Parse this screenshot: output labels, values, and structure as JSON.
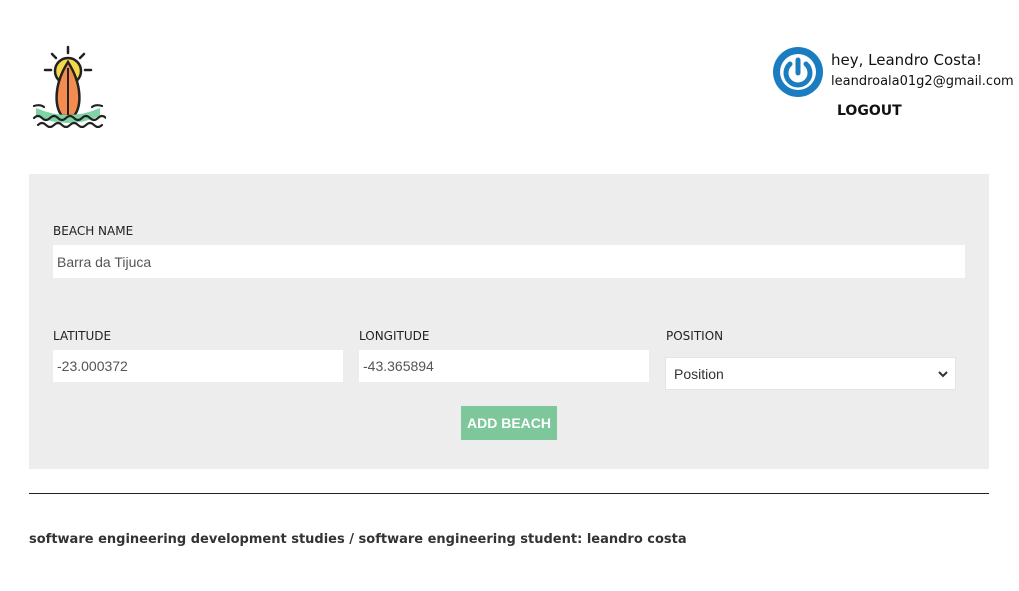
{
  "header": {
    "logo_icon": "surfboard-sun-icon",
    "user": {
      "avatar_icon": "power-icon",
      "greeting": "hey, Leandro Costa!",
      "email": "leandroala01g2@gmail.com",
      "logout_label": "LOGOUT"
    }
  },
  "form": {
    "beach_name": {
      "label": "BEACH NAME",
      "value": "Barra da Tijuca"
    },
    "latitude": {
      "label": "LATITUDE",
      "value": "-23.000372"
    },
    "longitude": {
      "label": "LONGITUDE",
      "value": "-43.365894"
    },
    "position": {
      "label": "POSITION",
      "selected": "Position"
    },
    "submit_label": "ADD BEACH",
    "colors": {
      "panel": "#ededed",
      "button": "#7dc79b"
    }
  },
  "footer": {
    "text": "software engineering development studies / software engineering student: leandro costa"
  }
}
